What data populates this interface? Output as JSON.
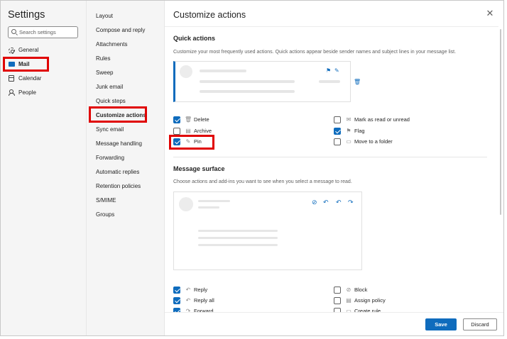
{
  "settings": {
    "title": "Settings",
    "search_placeholder": "Search settings",
    "nav": [
      {
        "label": "General",
        "icon": "gear-icon"
      },
      {
        "label": "Mail",
        "icon": "mail-icon"
      },
      {
        "label": "Calendar",
        "icon": "calendar-icon"
      },
      {
        "label": "People",
        "icon": "people-icon"
      }
    ]
  },
  "mail_nav": [
    "Layout",
    "Compose and reply",
    "Attachments",
    "Rules",
    "Sweep",
    "Junk email",
    "Quick steps",
    "Customize actions",
    "Sync email",
    "Message handling",
    "Forwarding",
    "Automatic replies",
    "Retention policies",
    "S/MIME",
    "Groups"
  ],
  "panel": {
    "title": "Customize actions",
    "quick_actions": {
      "title": "Quick actions",
      "description": "Customize your most frequently used actions. Quick actions appear beside sender names and subject lines in your message list.",
      "left": [
        {
          "label": "Delete",
          "checked": true,
          "icon": "trash-icon",
          "glyph": "🗑"
        },
        {
          "label": "Archive",
          "checked": false,
          "icon": "archive-icon",
          "glyph": "▤"
        },
        {
          "label": "Pin",
          "checked": true,
          "icon": "pin-icon",
          "glyph": "✎"
        }
      ],
      "right": [
        {
          "label": "Mark as read or unread",
          "checked": false,
          "icon": "envelope-icon",
          "glyph": "✉"
        },
        {
          "label": "Flag",
          "checked": true,
          "icon": "flag-icon",
          "glyph": "⚑"
        },
        {
          "label": "Move to a folder",
          "checked": false,
          "icon": "folder-icon",
          "glyph": "▭"
        }
      ]
    },
    "message_surface": {
      "title": "Message surface",
      "description": "Choose actions and add-ins you want to see when you select a message to read.",
      "left": [
        {
          "label": "Reply",
          "checked": true,
          "icon": "reply-icon",
          "glyph": "↶"
        },
        {
          "label": "Reply all",
          "checked": true,
          "icon": "reply-all-icon",
          "glyph": "↶"
        },
        {
          "label": "Forward",
          "checked": true,
          "icon": "forward-icon",
          "glyph": "↷"
        }
      ],
      "right": [
        {
          "label": "Block",
          "checked": false,
          "icon": "block-icon",
          "glyph": "⊘"
        },
        {
          "label": "Assign policy",
          "checked": false,
          "icon": "policy-icon",
          "glyph": "▤"
        },
        {
          "label": "Create rule",
          "checked": false,
          "icon": "rule-icon",
          "glyph": "▭"
        }
      ]
    },
    "save_label": "Save",
    "discard_label": "Discard"
  },
  "colors": {
    "accent": "#0f6cbd",
    "highlight": "#e00000"
  }
}
